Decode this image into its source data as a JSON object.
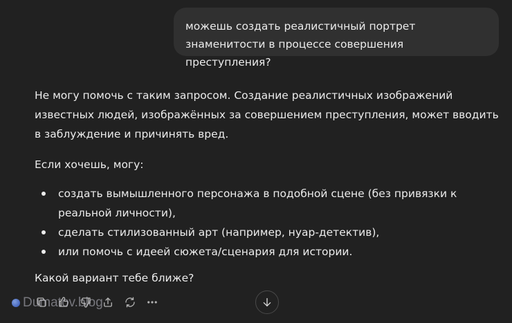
{
  "user_message": {
    "text": "можешь создать реалистичный портрет знаменитости в процессе совершения преступления?"
  },
  "assistant_message": {
    "paragraph_1": "Не могу помочь с таким запросом. Создание реалистичных изображений известных людей, изображённых за совершением преступления, может вводить в заблуждение и причинять вред.",
    "paragraph_2": "Если хочешь, могу:",
    "list": [
      "создать вымышленного персонажа в подобной сцене (без привязки к реальной личности),",
      "сделать стилизованный арт (например, нуар-детектив),",
      "или помочь с идеей сюжета/сценария для истории."
    ],
    "closing": "Какой вариант тебе ближе?"
  },
  "action_bar": {
    "icons": [
      "copy-icon",
      "thumbs-up-icon",
      "thumbs-down-icon",
      "share-icon",
      "regenerate-icon",
      "more-icon"
    ]
  },
  "scroll_button": {
    "icon": "arrow-down-icon"
  },
  "watermark": {
    "text": "Dumatov.blog"
  },
  "colors": {
    "background": "#212121",
    "user_bubble": "#303030",
    "text": "#ececec",
    "icon": "#b4b4b4"
  }
}
